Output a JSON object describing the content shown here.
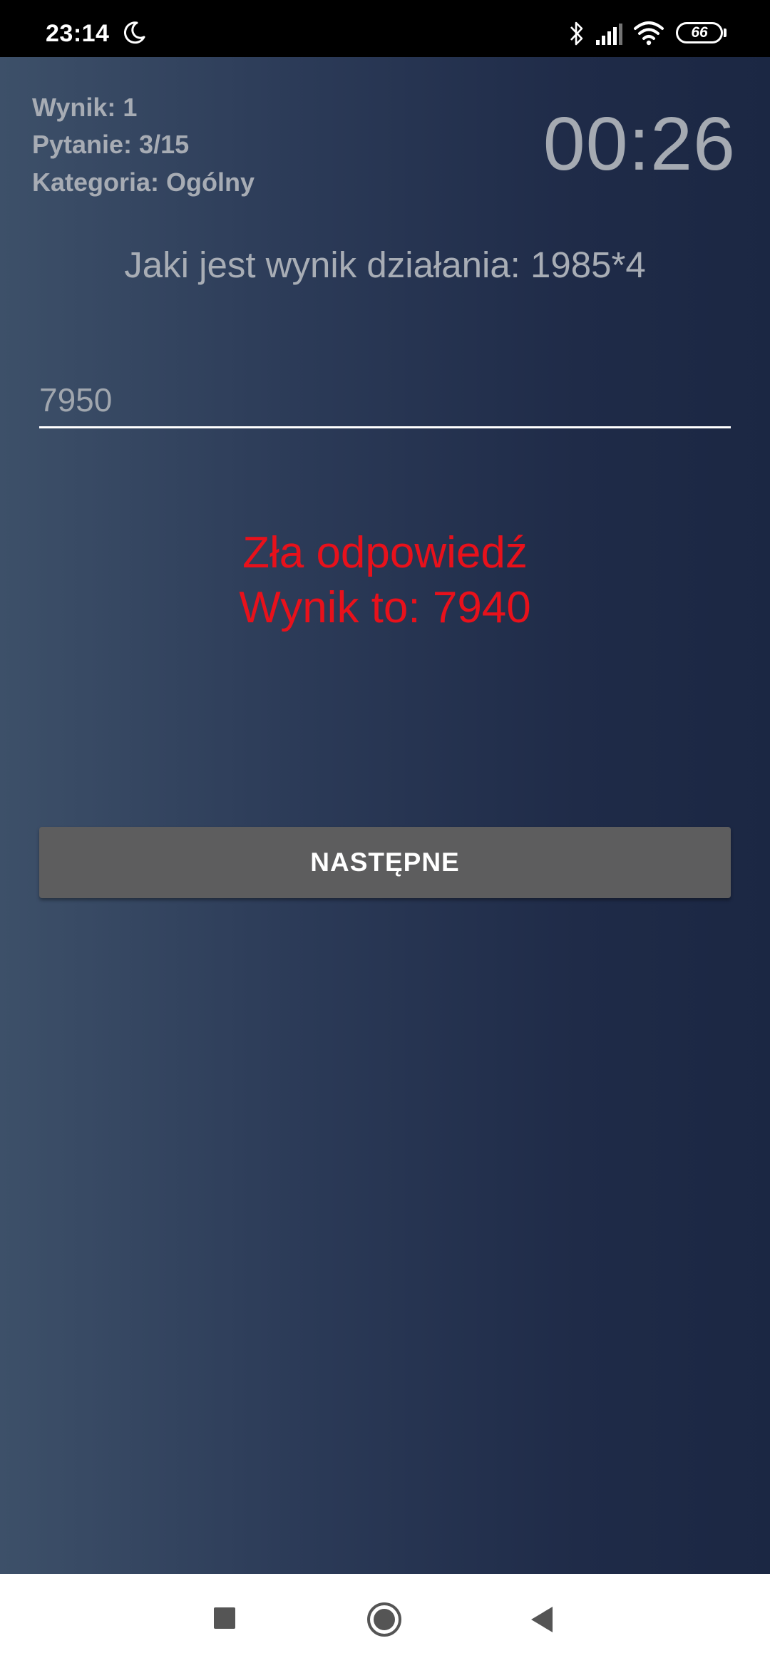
{
  "status_bar": {
    "time": "23:14",
    "battery_level": "66",
    "icons": [
      "moon-icon",
      "bluetooth-icon",
      "signal-icon",
      "wifi-icon",
      "battery-icon"
    ]
  },
  "quiz": {
    "score_label": "Wynik: 1",
    "question_counter": "Pytanie: 3/15",
    "category_label": "Kategoria: Ogólny",
    "timer": "00:26",
    "question": "Jaki jest wynik działania: 1985*4",
    "answer_value": "7950",
    "feedback_line1": "Zła odpowiedź",
    "feedback_line2": "Wynik to: 7940",
    "next_button_label": "NASTĘPNE"
  },
  "nav_bar": {
    "icons": [
      "recents-icon",
      "home-icon",
      "back-icon"
    ]
  },
  "colors": {
    "feedback": "#e8111b",
    "button": "#5d5d5e",
    "background_left": "#3d5069",
    "background_right": "#1b2743"
  }
}
